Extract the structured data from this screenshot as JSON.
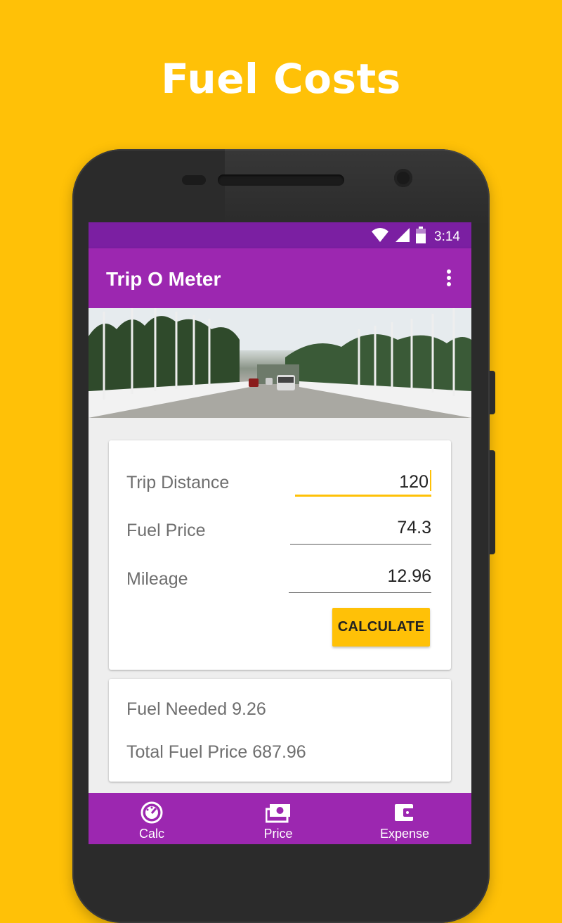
{
  "promo": {
    "headline": "Fuel Costs"
  },
  "statusbar": {
    "time": "3:14",
    "icons": [
      "wifi-icon",
      "signal-icon",
      "battery-icon"
    ]
  },
  "appbar": {
    "title": "Trip O Meter",
    "menu_icon": "more-vert-icon"
  },
  "form": {
    "fields": [
      {
        "label": "Trip Distance",
        "value": "120"
      },
      {
        "label": "Fuel Price",
        "value": "74.3"
      },
      {
        "label": "Mileage",
        "value": "12.96"
      }
    ],
    "calculate_label": "CALCULATE"
  },
  "result": {
    "fuel_needed": "Fuel Needed 9.26",
    "total_fuel_price": "Total Fuel Price 687.96"
  },
  "bottomnav": {
    "items": [
      {
        "label": "Calc",
        "icon": "speedometer-icon"
      },
      {
        "label": "Price",
        "icon": "money-icon"
      },
      {
        "label": "Expense",
        "icon": "wallet-icon"
      }
    ]
  },
  "colors": {
    "background": "#FFC107",
    "primary": "#9C27B0",
    "primary_dark": "#7B1FA2",
    "accent": "#FFC107"
  }
}
